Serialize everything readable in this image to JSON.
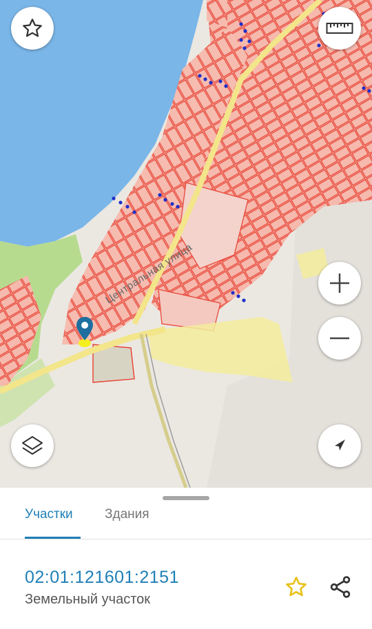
{
  "map": {
    "street_label": "Центральная улица",
    "icons": {
      "favorite": "star-outline-icon",
      "ruler": "ruler-icon",
      "zoom_in": "plus-icon",
      "zoom_out": "minus-icon",
      "layers": "layers-icon",
      "locate": "navigation-arrow-icon",
      "marker": "location-pin-icon"
    },
    "colors": {
      "water": "#7ab6e8",
      "parcel_fill": "#f5b7ab",
      "parcel_stroke": "#e8483a",
      "road": "#f3e58a",
      "zone": "#f3ec9c",
      "green": "#b7db8e",
      "marker": "#1e6f9f"
    }
  },
  "tabs": [
    {
      "label": "Участки",
      "active": true
    },
    {
      "label": "Здания",
      "active": false
    }
  ],
  "parcel": {
    "number": "02:01:121601:2151",
    "type": "Земельный участок"
  },
  "accent_color": "#1e7fb6",
  "favorite_icon_color": "#e8c21b"
}
